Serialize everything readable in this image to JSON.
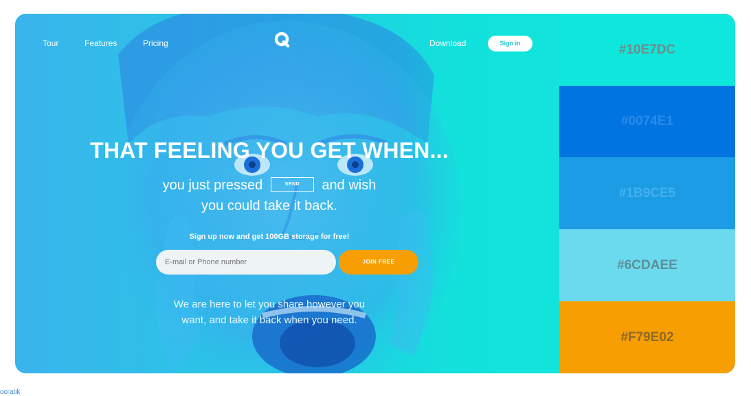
{
  "nav": {
    "tour": "Tour",
    "features": "Features",
    "pricing": "Pricing",
    "download": "Download",
    "signin": "Sign in"
  },
  "hero": {
    "headline": "THAT FEELING YOU GET WHEN...",
    "sub_before": "you just pressed",
    "send_label": "SEND",
    "sub_after": "and wish",
    "sub_line2": "you could take it back.",
    "promo": "Sign up now and get 100GB storage for free!",
    "email_placeholder": "E-mail or Phone number",
    "join_label": "JOIN FREE",
    "bottom_line1": "We are here to let you share however you",
    "bottom_line2": "want, and take it back when you need."
  },
  "palette": [
    {
      "label": "#10E7DC",
      "color": "#10E7DC",
      "text_color": "#6b8e8c"
    },
    {
      "label": "#0074E1",
      "color": "#0074E1",
      "text_color": "#2a8ae8"
    },
    {
      "label": "#1B9CE5",
      "color": "#1B9CE5",
      "text_color": "#45b0ec"
    },
    {
      "label": "#6CDAEE",
      "color": "#6CDAEE",
      "text_color": "#5d8e98"
    },
    {
      "label": "#F79E02",
      "color": "#F79E02",
      "text_color": "#8c6a2a"
    }
  ],
  "credit": "ocratik",
  "colors": {
    "accent": "#F79E02",
    "brand": "#10E7DC"
  }
}
